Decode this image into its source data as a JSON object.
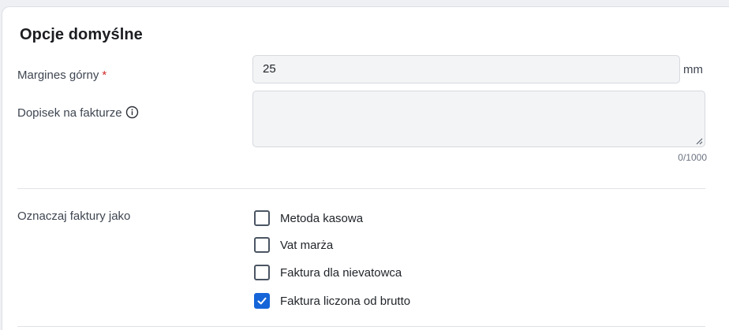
{
  "section": {
    "title": "Opcje domyślne"
  },
  "top_margin": {
    "label": "Margines górny",
    "required_mark": "*",
    "value": "25",
    "unit": "mm"
  },
  "invoice_note": {
    "label": "Dopisek na fakturze",
    "info_icon": "info-circle-icon",
    "value": "",
    "counter": "0/1000"
  },
  "mark_invoices": {
    "label": "Oznaczaj faktury jako",
    "options": [
      {
        "label": "Metoda kasowa",
        "checked": false
      },
      {
        "label": "Vat marża",
        "checked": false
      },
      {
        "label": "Faktura dla nievatowca",
        "checked": false
      },
      {
        "label": "Faktura liczona od brutto",
        "checked": true
      }
    ]
  },
  "colors": {
    "accent": "#1565d8",
    "required": "#d02b2b"
  }
}
